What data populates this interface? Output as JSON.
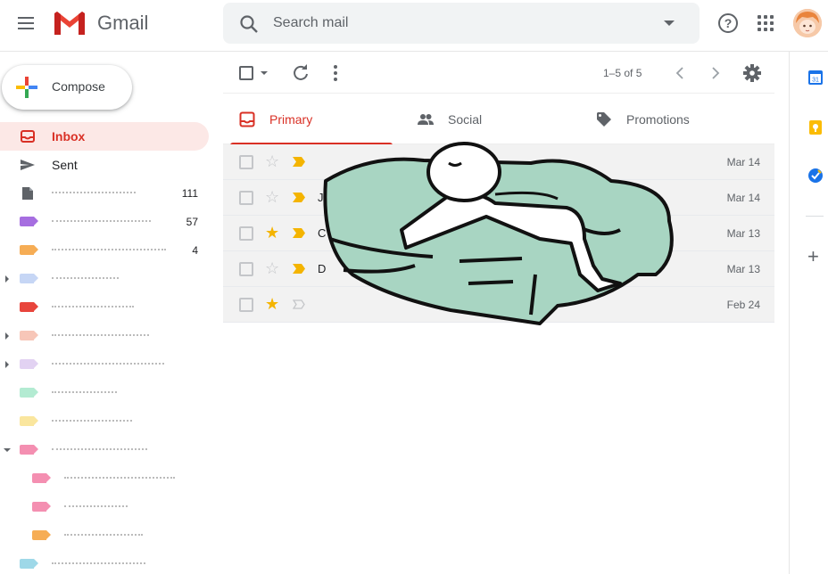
{
  "header": {
    "app_name": "Gmail",
    "search_placeholder": "Search mail"
  },
  "compose": {
    "label": "Compose"
  },
  "nav": {
    "items": [
      {
        "label": "Inbox",
        "count": "",
        "icon": "inbox-icon",
        "active": true
      },
      {
        "label": "Sent",
        "count": "",
        "icon": "send-icon"
      },
      {
        "label": "",
        "count": "111",
        "icon": "file-icon"
      },
      {
        "label": "",
        "count": "57",
        "icon": "label-icon",
        "color": "#a66ee0"
      },
      {
        "label": "",
        "count": "4",
        "icon": "label-icon",
        "color": "#f6ad55"
      },
      {
        "label": "",
        "count": "",
        "icon": "label-icon",
        "color": "#c6d6f5",
        "expander": "closed"
      },
      {
        "label": "",
        "count": "",
        "icon": "label-icon",
        "color": "#e8453c"
      },
      {
        "label": "",
        "count": "",
        "icon": "label-icon",
        "color": "#f7c6b8",
        "expander": "closed"
      },
      {
        "label": "",
        "count": "",
        "icon": "label-icon",
        "color": "#e2d2f2",
        "expander": "closed"
      },
      {
        "label": "",
        "count": "",
        "icon": "label-icon",
        "color": "#b3ebd2"
      },
      {
        "label": "",
        "count": "",
        "icon": "label-icon",
        "color": "#fae69e"
      },
      {
        "label": "",
        "count": "",
        "icon": "label-icon",
        "color": "#f48fb1",
        "expander": "open"
      },
      {
        "label": "",
        "count": "",
        "icon": "label-icon",
        "color": "#f48fb1",
        "indent": true
      },
      {
        "label": "",
        "count": "",
        "icon": "label-icon",
        "color": "#f48fb1",
        "indent": true
      },
      {
        "label": "",
        "count": "",
        "icon": "label-icon",
        "color": "#f6ad55",
        "indent": true
      },
      {
        "label": "",
        "count": "",
        "icon": "label-icon",
        "color": "#9ed8e8"
      }
    ]
  },
  "toolbar": {
    "page_info": "1–5 of 5"
  },
  "tabs": [
    {
      "label": "Primary",
      "icon": "inbox-icon",
      "active": true
    },
    {
      "label": "Social",
      "icon": "people-icon"
    },
    {
      "label": "Promotions",
      "icon": "tag-icon"
    }
  ],
  "mail": [
    {
      "text": "",
      "date": "Mar 14",
      "starred": false,
      "important": true
    },
    {
      "text": "J",
      "date": "Mar 14",
      "starred": false,
      "important": true
    },
    {
      "text": "C",
      "date": "Mar 13",
      "starred": true,
      "important": true
    },
    {
      "text": "D",
      "date": "Mar 13",
      "starred": false,
      "important": true
    },
    {
      "text": "",
      "date": "Feb 24",
      "starred": true,
      "important": false
    }
  ],
  "colors": {
    "accent": "#d93025",
    "star": "#f4b400",
    "important": "#f4b400",
    "sticker_fill": "#a8d5c2"
  },
  "side_panel": {
    "apps": [
      "calendar-icon",
      "keep-icon",
      "tasks-icon"
    ],
    "calendar_day": "31"
  }
}
